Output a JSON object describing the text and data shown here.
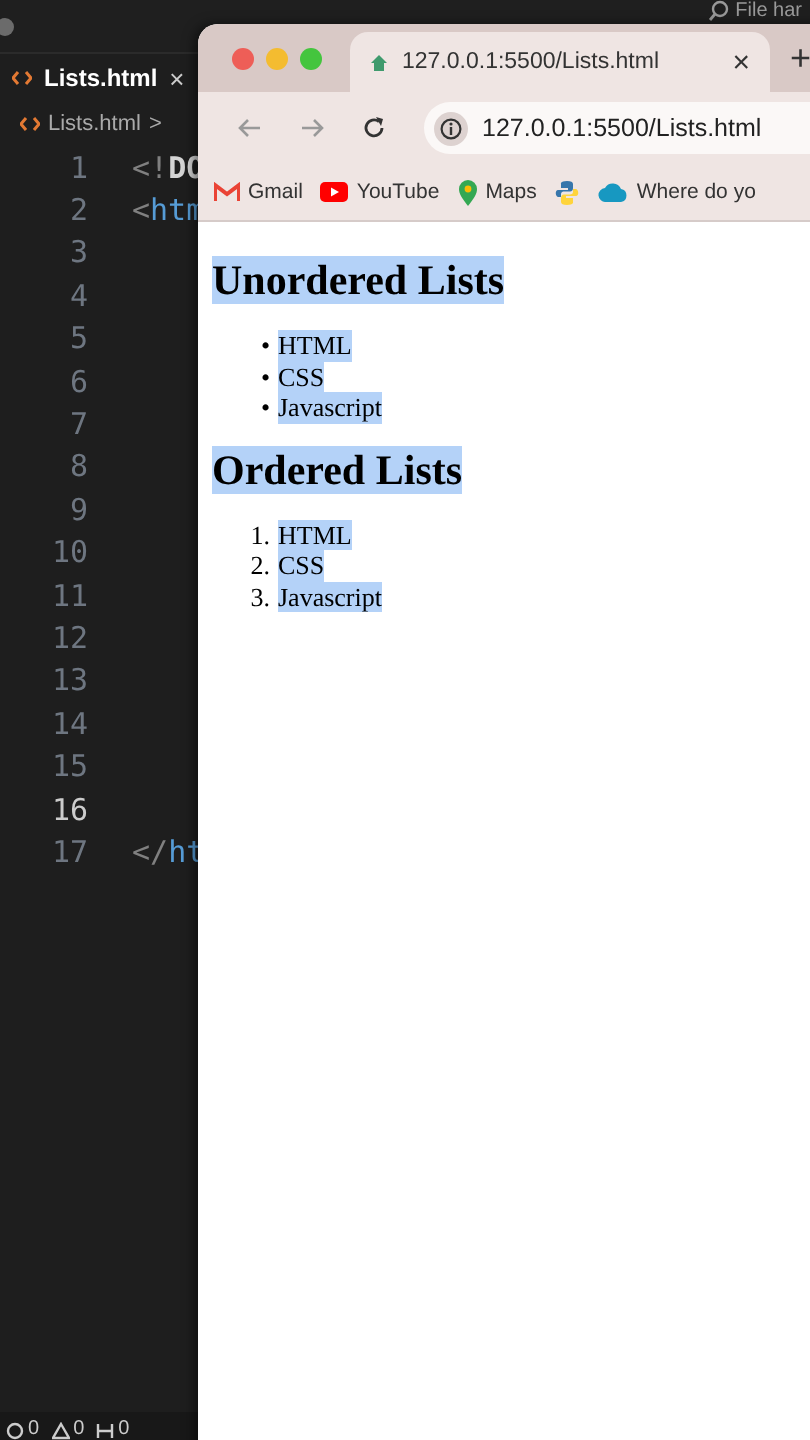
{
  "editor": {
    "search": "File har",
    "tabs": [
      {
        "label": "Lists.html",
        "close": "×",
        "selected": true
      }
    ],
    "breadcrumb": {
      "file": "Lists.html",
      "separator": ">"
    },
    "lines": [
      {
        "number": "1",
        "current": false,
        "tokens": [
          {
            "text": "<!",
            "kind": "punct"
          },
          {
            "text": "DO",
            "kind": "doctype"
          }
        ]
      },
      {
        "number": "2",
        "current": false,
        "tokens": [
          {
            "text": "<",
            "kind": "punct"
          },
          {
            "text": "htm",
            "kind": "tag"
          }
        ]
      },
      {
        "number": "3",
        "current": false
      },
      {
        "number": "4",
        "current": false
      },
      {
        "number": "5",
        "current": false
      },
      {
        "number": "6",
        "current": false
      },
      {
        "number": "7",
        "current": false
      },
      {
        "number": "8",
        "current": false
      },
      {
        "number": "9",
        "current": false
      },
      {
        "number": "10",
        "current": false
      },
      {
        "number": "11",
        "current": false
      },
      {
        "number": "12",
        "current": false
      },
      {
        "number": "13",
        "current": false
      },
      {
        "number": "14",
        "current": false
      },
      {
        "number": "15",
        "current": false
      },
      {
        "number": "16",
        "current": true
      },
      {
        "number": "17",
        "current": false,
        "tokens": [
          {
            "text": "</",
            "kind": "punct"
          },
          {
            "text": "ht",
            "kind": "tag"
          }
        ]
      }
    ],
    "status_bar": [
      {
        "kind": "errors",
        "count": "0"
      },
      {
        "kind": "warnings",
        "count": "0"
      },
      {
        "kind": "ports",
        "count": "0"
      }
    ]
  },
  "browser": {
    "tabs": [
      {
        "title": "127.0.0.1:5500/Lists.html",
        "close": "×",
        "selected": true
      }
    ],
    "new_tab": "+",
    "address": "127.0.0.1:5500/Lists.html",
    "bookmarks": [
      {
        "kind": "gmail",
        "label": "Gmail"
      },
      {
        "kind": "youtube",
        "label": "YouTube"
      },
      {
        "kind": "maps",
        "label": "Maps"
      },
      {
        "kind": "python"
      },
      {
        "kind": "cloud",
        "label": "Where do yo"
      }
    ],
    "page": {
      "sections": [
        {
          "heading": "Unordered Lists",
          "highlighted": true,
          "items": [
            {
              "marker": "•",
              "text": "HTML",
              "highlighted": true
            },
            {
              "marker": "•",
              "text": "CSS",
              "highlighted": true
            },
            {
              "marker": "•",
              "text": "Javascript",
              "highlighted": true
            }
          ]
        },
        {
          "heading": "Ordered Lists",
          "highlighted": true,
          "items": [
            {
              "marker": "1.",
              "text": "HTML",
              "highlighted": true
            },
            {
              "marker": "2.",
              "text": "CSS",
              "highlighted": true
            },
            {
              "marker": "3.",
              "text": "Javascript",
              "highlighted": true
            }
          ]
        }
      ]
    }
  }
}
